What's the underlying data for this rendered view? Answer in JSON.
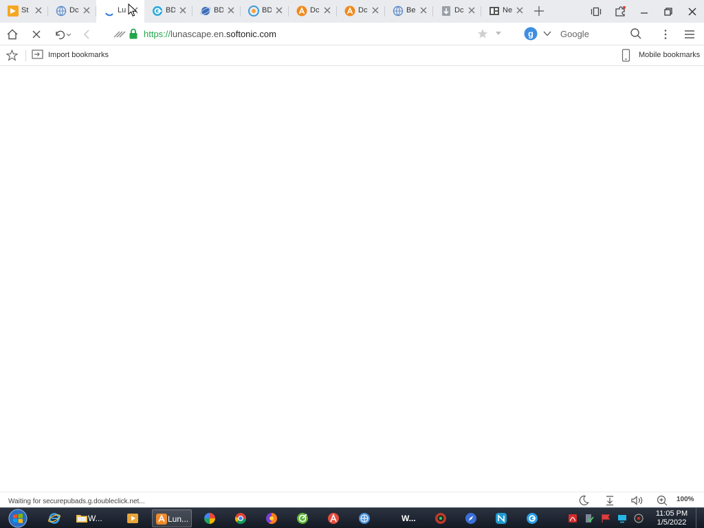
{
  "colors": {
    "tab_strip_bg": "#e9ebef",
    "url_scheme_green": "#23a54a",
    "taskbar_bg": "#1a2130",
    "notification_dot": "#e53935"
  },
  "tabs": [
    {
      "title": "St",
      "icon": "softonic-icon",
      "close_icon": "close-icon"
    },
    {
      "title": "Dc",
      "icon": "globe-icon",
      "close_icon": "close-icon"
    },
    {
      "title": "Lu",
      "icon": "loading-spinner-icon",
      "close_icon": "close-icon",
      "active": true
    },
    {
      "title": "BD",
      "icon": "browser-e-icon",
      "close_icon": "close-icon"
    },
    {
      "title": "BD",
      "icon": "globe-orbit-icon",
      "close_icon": "close-icon"
    },
    {
      "title": "BD",
      "icon": "browser-c-icon",
      "close_icon": "close-icon"
    },
    {
      "title": "Dc",
      "icon": "orange-a-icon",
      "close_icon": "close-icon"
    },
    {
      "title": "Dc",
      "icon": "orange-a-icon",
      "close_icon": "close-icon"
    },
    {
      "title": "Be",
      "icon": "globe-icon",
      "close_icon": "close-icon"
    },
    {
      "title": "Dc",
      "icon": "download-icon",
      "close_icon": "close-icon"
    },
    {
      "title": "Ne",
      "icon": "newspaper-icon",
      "close_icon": "close-icon"
    }
  ],
  "toolbar": {
    "url_scheme": "https://",
    "url_host": "lunascape.en.",
    "url_domain": "softonic.com",
    "search_engine": "Google",
    "icons": [
      "home-icon",
      "stop-icon",
      "undo-icon",
      "back-icon",
      "engine-switch-icon",
      "lock-icon",
      "star-icon",
      "chevron-down-icon",
      "search-icon",
      "more-vertical-icon",
      "hamburger-menu-icon"
    ]
  },
  "bookmarks_bar": {
    "import_label": "Import bookmarks",
    "mobile_label": "Mobile bookmarks"
  },
  "statusbar": {
    "status": "Waiting for securepubads.g.doubleclick.net...",
    "zoom": "100%",
    "icons": [
      "night-mode-icon",
      "download-icon",
      "volume-icon",
      "zoom-in-icon"
    ]
  },
  "taskbar": {
    "apps": [
      {
        "label": "",
        "icon": "internet-explorer-icon"
      },
      {
        "label": "W...",
        "icon": "folder-icon"
      },
      {
        "label": "",
        "icon": "media-player-icon"
      },
      {
        "label": "Lun...",
        "icon": "lunascape-icon",
        "active": true
      },
      {
        "label": "",
        "icon": "pinwheel-icon"
      },
      {
        "label": "",
        "icon": "chrome-like-icon"
      },
      {
        "label": "",
        "icon": "firefox-like-icon"
      },
      {
        "label": "",
        "icon": "green-browser-icon"
      },
      {
        "label": "",
        "icon": "red-a-icon"
      },
      {
        "label": "",
        "icon": "blue-globe-icon"
      },
      {
        "label": "W...",
        "icon": ""
      },
      {
        "label": "",
        "icon": "red-browser-icon"
      },
      {
        "label": "",
        "icon": "blue-compass-icon"
      },
      {
        "label": "",
        "icon": "teal-browser-icon"
      },
      {
        "label": "",
        "icon": "blue-e-icon"
      }
    ],
    "clock_time": "11:05 PM",
    "clock_date": "1/5/2022"
  }
}
